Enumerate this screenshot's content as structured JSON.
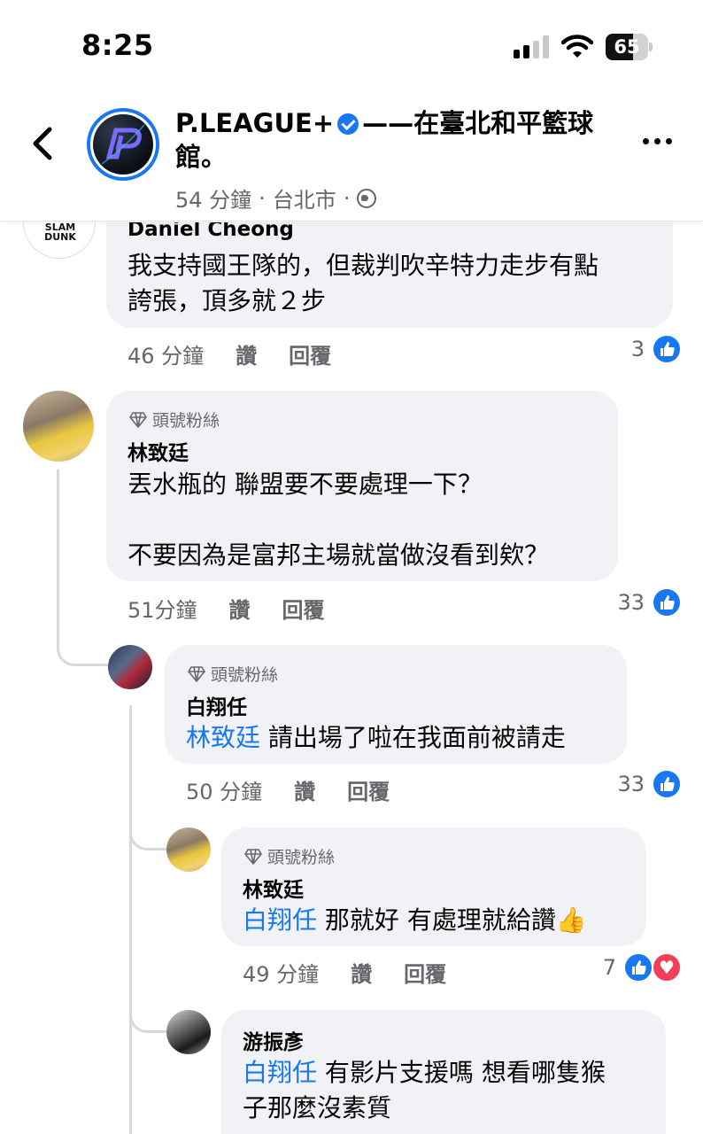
{
  "status_bar": {
    "time": "8:25",
    "battery": "65",
    "battery_level": 0.65
  },
  "header": {
    "page_name": "P.LEAGUE+",
    "location_text": "——在臺北和平籃球館。",
    "timestamp": "54 分鐘",
    "location": "台北市",
    "separator": "·"
  },
  "comments": [
    {
      "author": "Daniel Cheong",
      "text_line1": "我支持國王隊的，但裁判吹辛特力走步有點",
      "text_line2": "誇張，頂多就２步",
      "time": "46 分鐘",
      "like": "讚",
      "reply": "回覆",
      "likes": "3",
      "avatar_text": "SLAM DUNK"
    },
    {
      "badge": "頭號粉絲",
      "author": "林致廷",
      "text_line1": "丟水瓶的 聯盟要不要處理一下？",
      "text_line2": "不要因為是富邦主場就當做沒看到欸？",
      "time": "51分鐘",
      "like": "讚",
      "reply": "回覆",
      "likes": "33"
    },
    {
      "badge": "頭號粉絲",
      "author": "白翔任",
      "mention": "林致廷",
      "text": " 請出場了啦在我面前被請走",
      "time": "50 分鐘",
      "like": "讚",
      "reply": "回覆",
      "likes": "33"
    },
    {
      "badge": "頭號粉絲",
      "author": "林致廷",
      "mention": "白翔任",
      "text": " 那就好 有處理就給讚",
      "emoji": "👍",
      "time": "49 分鐘",
      "like": "讚",
      "reply": "回覆",
      "likes": "7"
    },
    {
      "author": "游振彥",
      "mention": "白翔任",
      "text_line1": " 有影片支援嗎 想看哪隻猴",
      "text_line2": "子那麼沒素質"
    }
  ],
  "icons": {
    "back": "chevron-left-icon",
    "verified": "verified-badge-icon",
    "globe": "globe-icon",
    "more": "more-horizontal-icon",
    "like": "like-thumb-icon",
    "love": "love-heart-icon",
    "badge": "diamond-icon"
  },
  "colors": {
    "accent": "#1877f2",
    "love": "#f33e58",
    "bubble": "#f0f2f5",
    "muted": "#65676b"
  }
}
